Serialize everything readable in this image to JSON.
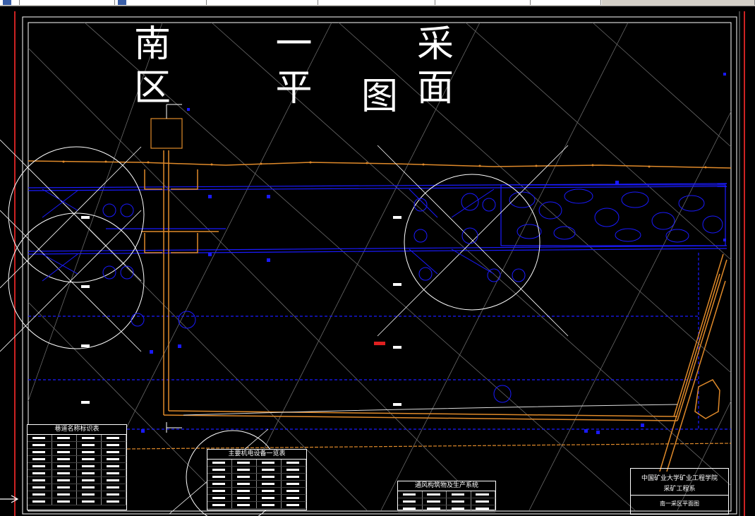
{
  "drawing": {
    "title": "南 一 采 区 平 面",
    "title_line2": "图",
    "background_color": "#000000",
    "roadway_color_blue": "#1a1aff",
    "roadway_color_orange": "#e08a2a",
    "border_color_red": "#cc2222"
  },
  "tables": {
    "roadway_legend": {
      "header": "巷道名称标识表"
    },
    "equipment_list": {
      "header": "主要机电设备一览表"
    },
    "ventilation": {
      "header": "通风构筑物及生产系统"
    }
  },
  "title_block": {
    "institution": "中国矿业大学矿业工程学院",
    "department": "采矿工程系",
    "drawing_name": "南一采区平面图"
  },
  "icons": {
    "left_arrow": "arrow-right-icon"
  }
}
